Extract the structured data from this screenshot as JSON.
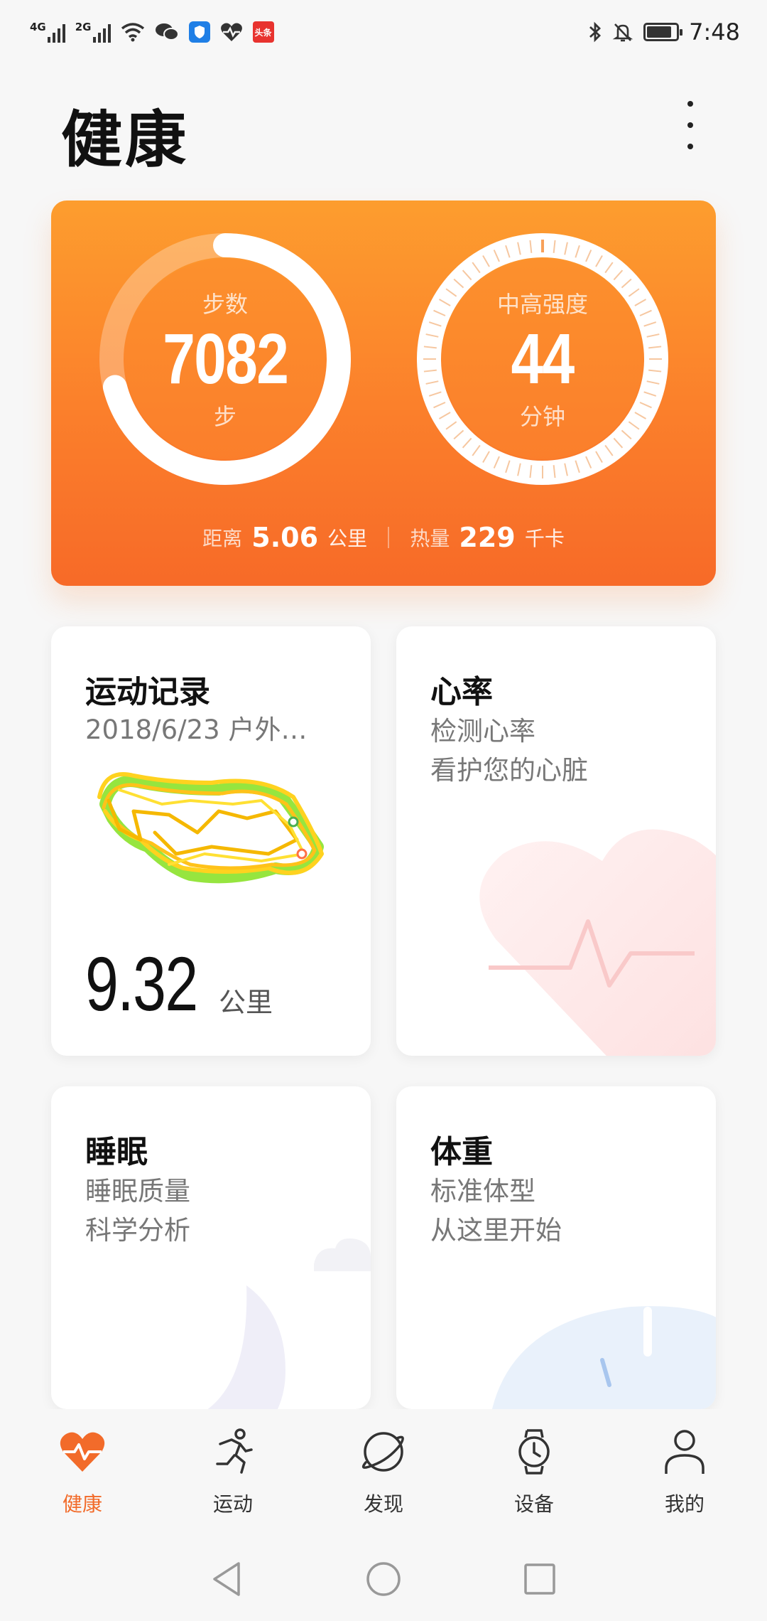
{
  "status_bar": {
    "net1": "4G",
    "net2": "2G",
    "app_badge": "头条",
    "time": "7:48"
  },
  "header": {
    "title": "健康"
  },
  "hero": {
    "steps": {
      "label": "步数",
      "value": "7082",
      "unit": "步",
      "progress": 0.71
    },
    "intensity": {
      "label": "中高强度",
      "value": "44",
      "unit": "分钟"
    },
    "distance": {
      "label": "距离",
      "value": "5.06",
      "unit": "公里"
    },
    "calories": {
      "label": "热量",
      "value": "229",
      "unit": "千卡"
    }
  },
  "cards": {
    "exercise": {
      "title": "运动记录",
      "subtitle": "2018/6/23 户外…",
      "distance": "9.32",
      "unit": "公里"
    },
    "heart": {
      "title": "心率",
      "line1": "检测心率",
      "line2": "看护您的心脏"
    },
    "sleep": {
      "title": "睡眠",
      "line1": "睡眠质量",
      "line2": "科学分析"
    },
    "weight": {
      "title": "体重",
      "line1": "标准体型",
      "line2": "从这里开始"
    }
  },
  "tabs": [
    {
      "label": "健康",
      "icon": "heart-pulse-icon",
      "active": true
    },
    {
      "label": "运动",
      "icon": "running-icon",
      "active": false
    },
    {
      "label": "发现",
      "icon": "planet-icon",
      "active": false
    },
    {
      "label": "设备",
      "icon": "watch-icon",
      "active": false
    },
    {
      "label": "我的",
      "icon": "person-icon",
      "active": false
    }
  ],
  "colors": {
    "accent": "#f26b2a",
    "hero_top": "#fd9d2e",
    "hero_bottom": "#f76a28"
  }
}
